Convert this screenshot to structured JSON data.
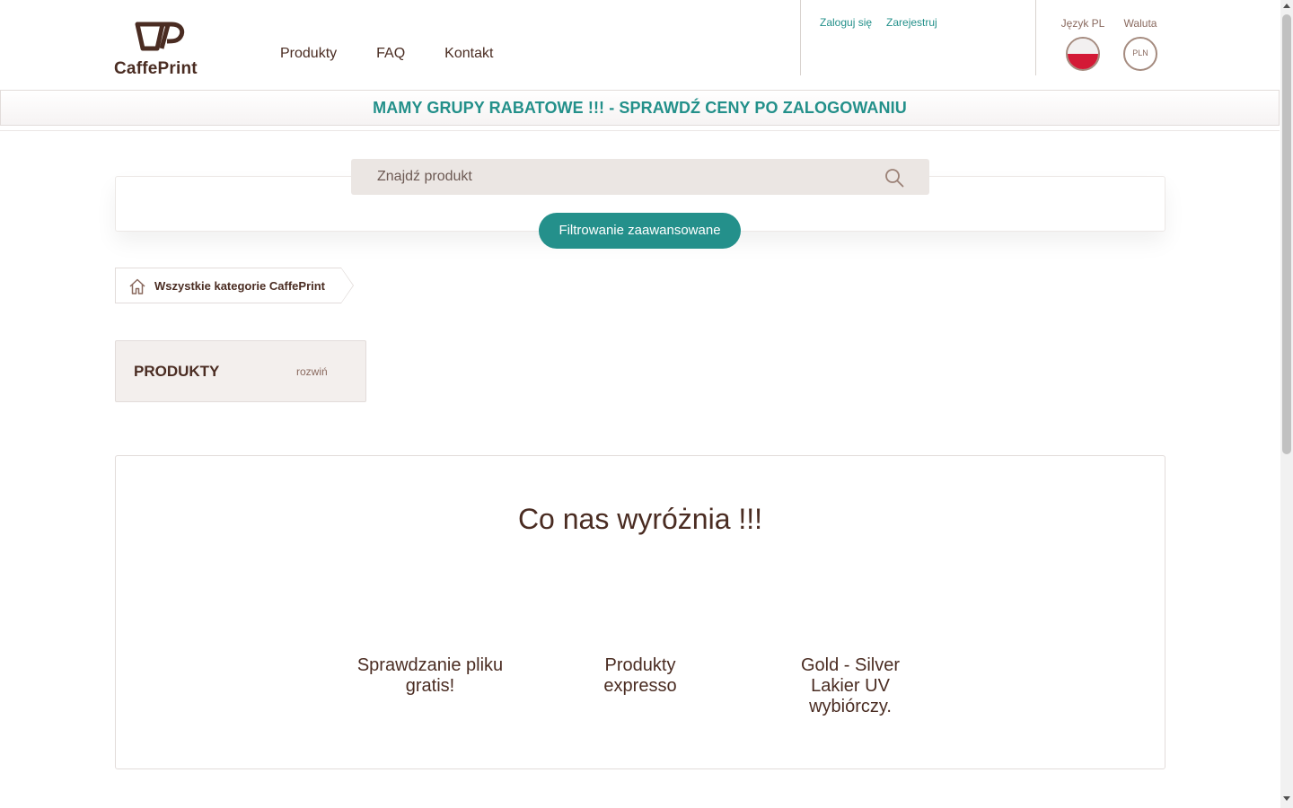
{
  "header": {
    "logo_text": "CaffePrint",
    "nav": [
      "Produkty",
      "FAQ",
      "Kontakt"
    ],
    "auth": {
      "login": "Zaloguj się",
      "register": "Zarejestruj"
    },
    "language": {
      "label": "Język PL",
      "flag": "poland-flag-icon"
    },
    "currency": {
      "label": "Waluta",
      "value": "PLN"
    }
  },
  "promo": {
    "text": "MAMY GRUPY RABATOWE !!! - SPRAWDŹ CENY PO ZALOGOWANIU"
  },
  "search": {
    "placeholder": "Znajdź produkt",
    "icon": "search-icon",
    "advanced_filter_label": "Filtrowanie zaawansowane"
  },
  "breadcrumb": {
    "home_icon": "home-icon",
    "label": "Wszystkie kategorie CaffePrint"
  },
  "products_panel": {
    "title": "PRODUKTY",
    "toggle": "rozwiń"
  },
  "features": {
    "title": "Co nas wyróżnia !!!",
    "items": [
      "Sprawdzanie pliku gratis!",
      "Produkty expresso",
      "Gold - Silver Lakier UV wybiórczy."
    ]
  },
  "colors": {
    "accent": "#23908a",
    "text": "#4a2c22",
    "muted": "#8a6a5f",
    "panel": "#f3efed"
  }
}
